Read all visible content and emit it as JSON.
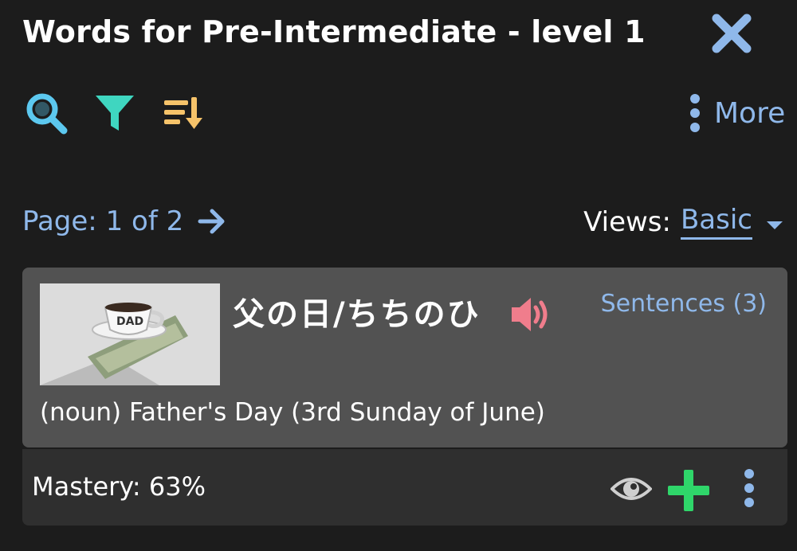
{
  "header": {
    "title": "Words for Pre-Intermediate - level 1",
    "close_icon": "close-icon"
  },
  "toolbar": {
    "icons": [
      "search-icon",
      "filter-icon",
      "sort-icon"
    ],
    "more_label": "More",
    "colors": {
      "search": "#5cc8ef",
      "filter": "#3fd6c0",
      "sort": "#f6c36a",
      "link": "#8fb8ea",
      "close": "#8fb8ea"
    }
  },
  "pagination": {
    "label": "Page: 1 of 2",
    "next_icon": "arrow-right-icon"
  },
  "views": {
    "label": "Views:",
    "selected": "Basic"
  },
  "card": {
    "word": "父の日/ちちのひ",
    "audio_icon": "speaker-icon",
    "sentences_link": "Sentences (3)",
    "definition": "(noun) Father's Day (3rd Sunday of June)",
    "image_text": "DAD"
  },
  "footer": {
    "mastery": "Mastery: 63%",
    "icons": [
      "eye-icon",
      "add-icon",
      "more-vertical-icon"
    ],
    "colors": {
      "add": "#2fd66a",
      "eye": "#cfcfcf",
      "more": "#8fb8ea"
    }
  }
}
